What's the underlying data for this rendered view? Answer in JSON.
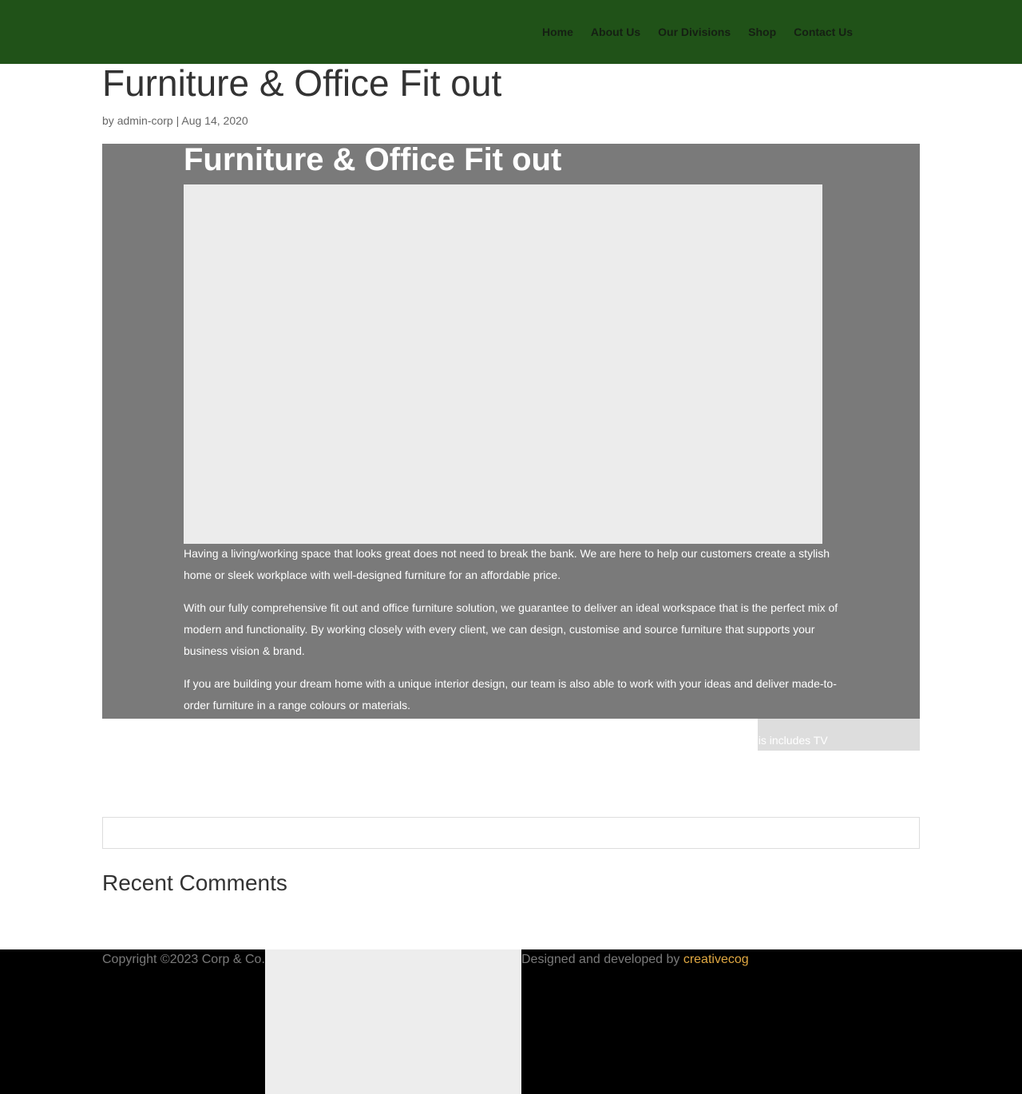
{
  "nav": {
    "items": [
      "Home",
      "About Us",
      "Our Divisions",
      "Shop",
      "Contact Us"
    ]
  },
  "post": {
    "title": "Furniture & Office Fit out",
    "meta_prefix": "by",
    "author": "admin-corp",
    "separator": "|",
    "date": "Aug 14, 2020"
  },
  "hero": {
    "title": "Furniture & Office Fit out",
    "paragraphs": [
      "Having a living/working space that looks great does not need to break the bank. We are here to help our customers create a stylish home or sleek workplace with well-designed furniture for an affordable price.",
      "With our fully comprehensive fit out and office furniture solution, we guarantee to deliver an ideal workspace that is the perfect mix of modern and functionality. By working closely with every client, we can design, customise and source furniture that supports your business vision & brand.",
      "If you are building your dream home with a unique interior design, our team is also able to work with your ideas and deliver made-to-order furniture in a range colours or materials."
    ],
    "overflow_text": "his includes TV"
  },
  "sidebar": {
    "recent_comments_title": "Recent Comments"
  },
  "footer": {
    "copyright": "Copyright ©2023 Corp & Co.",
    "credits_prefix": "Designed and developed by",
    "credits_link": "creativecog"
  },
  "colors": {
    "header_bg": "#205218",
    "hero_bg": "#7a7a7a",
    "footer_bg": "#000000",
    "link_accent": "#e0a842"
  }
}
